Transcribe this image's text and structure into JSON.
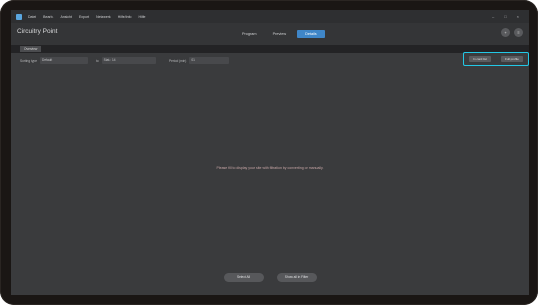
{
  "menu": [
    "Datei",
    "Bearb.",
    "Ansicht",
    "Export",
    "Netzwerk",
    "Hilfe/Info",
    "Hilfe"
  ],
  "window_controls": [
    "–",
    "□",
    "×"
  ],
  "app": {
    "title": "Circuitry Point"
  },
  "tabs": [
    {
      "label": "Program"
    },
    {
      "label": "Preview"
    },
    {
      "label": "Details"
    }
  ],
  "header_buttons": [
    "+",
    "≡"
  ],
  "subtab": {
    "label": "Overview"
  },
  "filters": {
    "first": {
      "label": "Sorting type",
      "value": "Default"
    },
    "second": {
      "prefix": "to",
      "value": "Stat.: 14"
    },
    "third": {
      "label": "Period (min)",
      "value": "01"
    }
  },
  "actions": {
    "left": "In card list",
    "right": "Full profile"
  },
  "empty_message": "Please fill to display your site with filtration by converting or manually.",
  "bottom": {
    "left": "Select All",
    "right": "Show all in Filter"
  },
  "colors": {
    "accent": "#3f86c8",
    "highlight": "#23c8e6"
  }
}
